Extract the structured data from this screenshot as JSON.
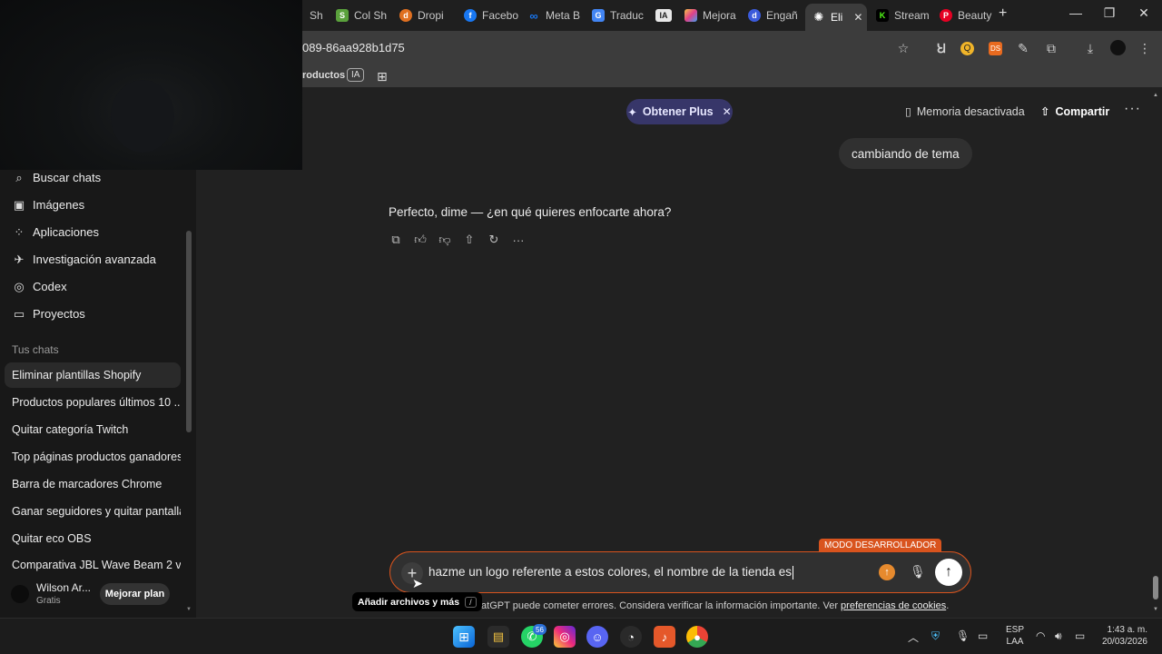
{
  "browser": {
    "tabs": [
      {
        "label": "Sh",
        "color": "#5aa13c",
        "icon": "shopify-icon"
      },
      {
        "label": "Col Sh",
        "color": "#5aa13c",
        "icon": "shopify-icon"
      },
      {
        "label": "Dropi",
        "color": "#e07020",
        "icon": "dropi-icon"
      },
      {
        "label": "Facebo",
        "color": "#1877f2",
        "icon": "facebook-icon"
      },
      {
        "label": "Meta B",
        "color": "#1877f2",
        "icon": "meta-icon"
      },
      {
        "label": "Traduc",
        "color": "#4285f4",
        "icon": "translate-icon"
      },
      {
        "label": "IA",
        "color": "#555555",
        "icon": "ia-icon"
      },
      {
        "label": "Mejora",
        "color": "#c040c0",
        "icon": "palette-icon"
      },
      {
        "label": "Engañ",
        "color": "#3b5bdb",
        "icon": "d-icon"
      },
      {
        "label": "Eli",
        "color": "#ffffff",
        "icon": "chatgpt-icon",
        "active": true
      },
      {
        "label": "Stream",
        "color": "#53fc18",
        "icon": "kick-icon"
      },
      {
        "label": "Beauty",
        "color": "#e60023",
        "icon": "pinterest-icon"
      }
    ],
    "url": "089-86aa928b1d75",
    "bookmarks": {
      "productos": "roductos",
      "ia": "IA"
    }
  },
  "sidebar": {
    "nav": [
      {
        "label": "Buscar chats",
        "icon": "search-icon",
        "glyph": "⌕"
      },
      {
        "label": "Imágenes",
        "icon": "image-icon",
        "glyph": "▣"
      },
      {
        "label": "Aplicaciones",
        "icon": "apps-icon",
        "glyph": "⁘"
      },
      {
        "label": "Investigación avanzada",
        "icon": "telescope-icon",
        "glyph": "✈"
      },
      {
        "label": "Codex",
        "icon": "codex-icon",
        "glyph": "◎"
      },
      {
        "label": "Proyectos",
        "icon": "folder-icon",
        "glyph": "▭"
      }
    ],
    "chats_heading": "Tus chats",
    "chats": [
      "Eliminar plantillas Shopify",
      "Productos populares últimos 10 ...",
      "Quitar categoría Twitch",
      "Top páginas productos ganadores",
      "Barra de marcadores Chrome",
      "Ganar seguidores y quitar pantalla",
      "Quitar eco OBS",
      "Comparativa JBL Wave Beam 2 v..."
    ],
    "user": {
      "name": "Wilson Ar...",
      "plan": "Gratis",
      "upgrade": "Mejorar plan"
    }
  },
  "header": {
    "plus": "Obtener Plus",
    "memory": "Memoria desactivada",
    "share": "Compartir"
  },
  "conversation": {
    "user_message": "cambiando de tema",
    "assistant_message": "Perfecto, dime — ¿en qué quieres enfocarte ahora?"
  },
  "composer": {
    "dev_mode": "MODO DESARROLLADOR",
    "text": "hazme un logo referente a estos colores, el nombre de la tienda es",
    "tooltip": "Añadir archivos y más",
    "tooltip_key": "/",
    "disclaimer": "ChatGPT puede cometer errores. Considera verificar la información importante. Ver",
    "disclaimer_link": "preferencias de cookies",
    "disclaimer_end": "."
  },
  "taskbar": {
    "whatsapp_badge": "56",
    "lang_top": "ESP",
    "lang_bottom": "LAA",
    "time": "1:43 a. m.",
    "date": "20/03/2026"
  }
}
